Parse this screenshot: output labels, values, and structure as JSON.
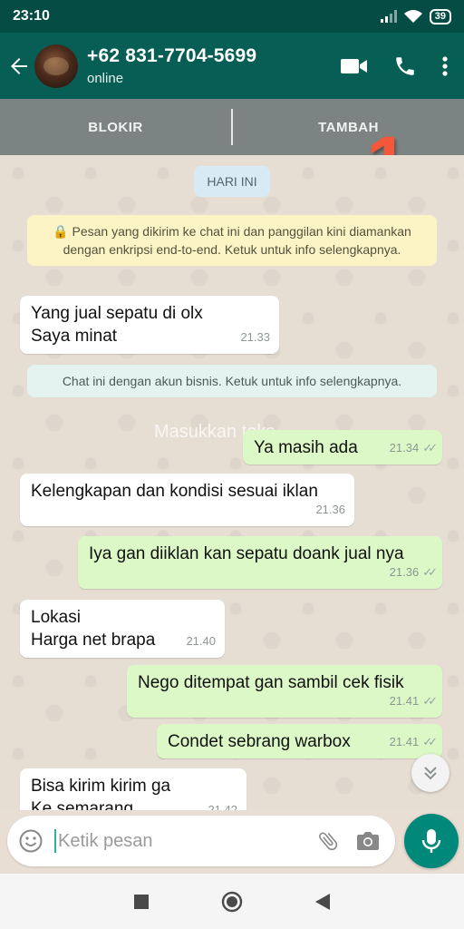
{
  "status_bar": {
    "time": "23:10",
    "battery": "39"
  },
  "header": {
    "contact_name": "+62 831-7704-5699",
    "contact_status": "online"
  },
  "action_bar": {
    "block_label": "BLOKIR",
    "add_label": "TAMBAH"
  },
  "annotation_number": "1",
  "chat": {
    "day_label": "HARI INI",
    "encryption_notice": "🔒 Pesan yang dikirim ke chat ini dan panggilan kini diamankan dengan enkripsi end-to-end. Ketuk untuk info selengkapnya.",
    "business_notice": "Chat ini dengan akun bisnis. Ketuk untuk info selengkapnya.",
    "watermark": "Masukkan teks",
    "messages": [
      {
        "direction": "in",
        "text": "Yang jual sepatu di olx\nSaya minat",
        "time": "21.33"
      },
      {
        "direction": "out",
        "text": "Ya masih ada",
        "time": "21.34",
        "read": true
      },
      {
        "direction": "in",
        "text": "Kelengkapan dan kondisi sesuai iklan",
        "time": "21.36"
      },
      {
        "direction": "out",
        "text": "Iya gan diiklan kan sepatu doank jual nya",
        "time": "21.36",
        "read": true
      },
      {
        "direction": "in",
        "text": "Lokasi\nHarga net brapa",
        "time": "21.40"
      },
      {
        "direction": "out",
        "text": "Nego ditempat gan sambil cek fisik",
        "time": "21.41",
        "read": true
      },
      {
        "direction": "out",
        "text": "Condet sebrang warbox",
        "time": "21.41",
        "read": true
      },
      {
        "direction": "in",
        "text": "Bisa kirim kirim ga\nKe semarang",
        "time": "21.42"
      }
    ]
  },
  "composer": {
    "placeholder": "Ketik pesan"
  },
  "colors": {
    "header": "#075e54",
    "outgoing_bubble": "#dcf8c6",
    "accent": "#00897b"
  }
}
